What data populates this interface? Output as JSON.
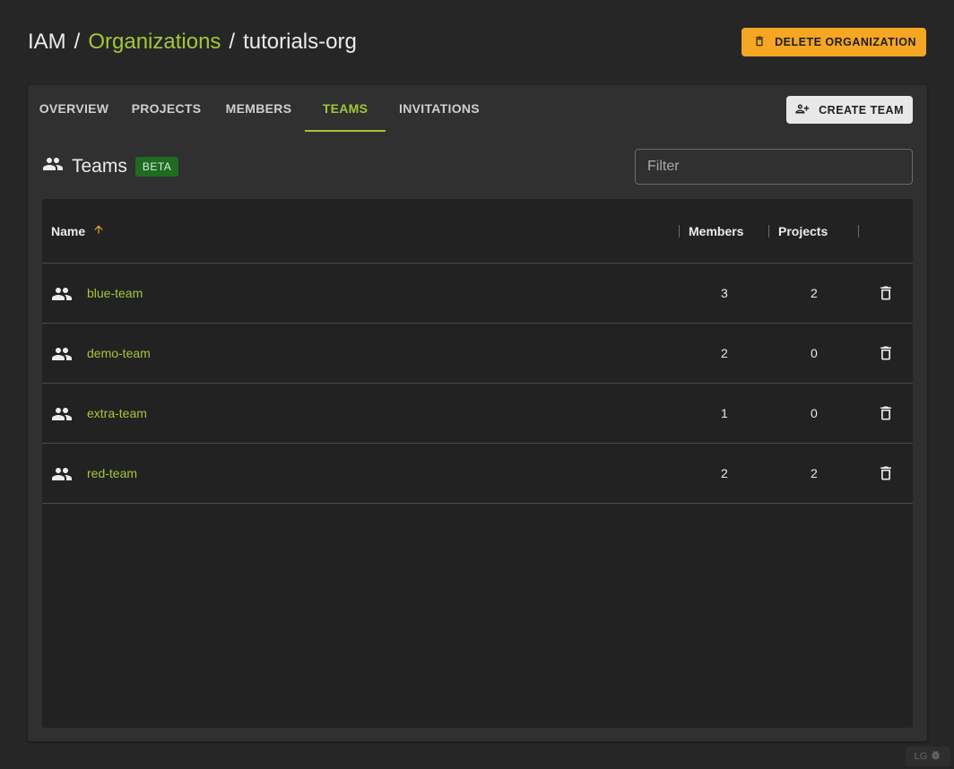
{
  "breadcrumb": {
    "root": "IAM",
    "sep1": "/",
    "organizations": "Organizations",
    "sep2": "/",
    "current": "tutorials-org"
  },
  "header": {
    "delete_org_label": "DELETE ORGANIZATION"
  },
  "tabs": [
    {
      "label": "OVERVIEW",
      "active": false
    },
    {
      "label": "PROJECTS",
      "active": false
    },
    {
      "label": "MEMBERS",
      "active": false
    },
    {
      "label": "TEAMS",
      "active": true
    },
    {
      "label": "INVITATIONS",
      "active": false
    }
  ],
  "toolbar": {
    "create_team_label": "CREATE TEAM"
  },
  "section": {
    "title": "Teams",
    "badge": "BETA",
    "filter_placeholder": "Filter"
  },
  "table": {
    "columns": {
      "name": "Name",
      "members": "Members",
      "projects": "Projects"
    },
    "rows": [
      {
        "name": "blue-team",
        "members": "3",
        "projects": "2"
      },
      {
        "name": "demo-team",
        "members": "2",
        "projects": "0"
      },
      {
        "name": "extra-team",
        "members": "1",
        "projects": "0"
      },
      {
        "name": "red-team",
        "members": "2",
        "projects": "2"
      }
    ]
  },
  "footer": {
    "badge_label": "LG"
  },
  "colors": {
    "accent": "#a4c639",
    "warning_button": "#f5a623",
    "beta_badge": "#1f6b22",
    "background": "#262626",
    "panel": "#303030"
  },
  "icons": {
    "sort": "arrow-up-icon",
    "team": "people-icon",
    "delete": "trash-icon",
    "add_team": "person-add-icon",
    "bug": "bug-icon"
  }
}
